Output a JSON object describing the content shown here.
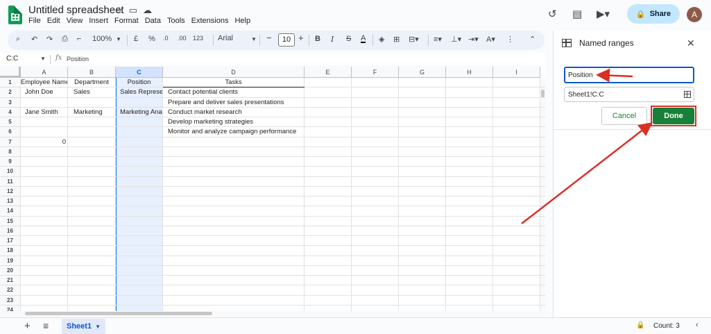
{
  "app": {
    "doc_title": "Untitled spreadsheet",
    "menu": [
      "File",
      "Edit",
      "View",
      "Insert",
      "Format",
      "Data",
      "Tools",
      "Extensions",
      "Help"
    ],
    "share_label": "Share",
    "avatar_initial": "A"
  },
  "toolbar": {
    "zoom": "100%",
    "currency": "£",
    "percent": "%",
    "dec_decrease": ".0",
    "dec_increase": ".00",
    "number_format": "123",
    "font": "Arial",
    "font_size": "10"
  },
  "formula_bar": {
    "name_box": "C:C",
    "fx": "fx",
    "value": "Position"
  },
  "grid": {
    "columns": [
      "A",
      "B",
      "C",
      "D",
      "E",
      "F",
      "G",
      "H",
      "I"
    ],
    "selected_column": "C",
    "rows": [
      "1",
      "2",
      "3",
      "4",
      "5",
      "6",
      "7",
      "8",
      "9",
      "10",
      "11",
      "12",
      "13",
      "14",
      "15",
      "16",
      "17",
      "18",
      "19",
      "20",
      "21",
      "22",
      "23",
      "24"
    ],
    "cells": {
      "A1": "Employee Name",
      "B1": "Department",
      "C1": "Position",
      "D1": "Tasks",
      "A2": "John Doe",
      "B2": "Sales",
      "C2": "Sales Representative",
      "D2": "Contact potential clients",
      "D3": "Prepare and deliver sales presentations",
      "A4": "Jane Smith",
      "B4": "Marketing",
      "C4": "Marketing Analyst",
      "D4": "Conduct market research",
      "D5": "Develop marketing strategies",
      "D6": "Monitor and analyze campaign performance",
      "A7": "0"
    }
  },
  "bottom_bar": {
    "sheet_name": "Sheet1",
    "count": "Count: 3"
  },
  "panel": {
    "title": "Named ranges",
    "range_name": "Position",
    "range_ref": "Sheet1!C:C",
    "cancel_label": "Cancel",
    "done_label": "Done"
  },
  "colors": {
    "accent": "#0b57d0",
    "done": "#188038",
    "annotation": "#d93025",
    "selection": "#e8f0fe"
  }
}
